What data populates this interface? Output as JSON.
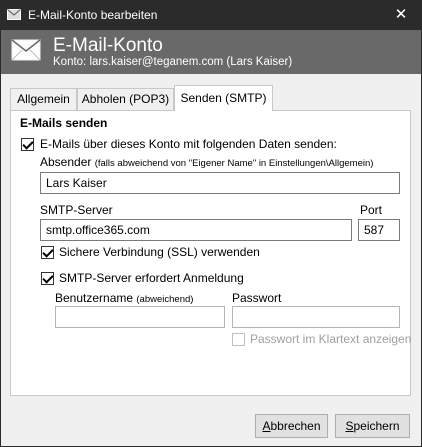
{
  "window": {
    "title": "E-Mail-Konto bearbeiten",
    "close_glyph": "✕",
    "title_icon": "mail-icon"
  },
  "header": {
    "title": "E-Mail-Konto",
    "subtitle": "Konto: lars.kaiser@teganem.com (Lars Kaiser)",
    "icon": "mail-icon"
  },
  "tabs": [
    {
      "label": "Allgemein",
      "active": false
    },
    {
      "label": "Abholen (POP3)",
      "active": false
    },
    {
      "label": "Senden (SMTP)",
      "active": true
    }
  ],
  "send": {
    "section_title": "E-Mails senden",
    "send_via_account": {
      "label": "E-Mails über dieses Konto mit folgenden Daten senden:",
      "checked": true
    },
    "sender_label": "Absender",
    "sender_hint": "(falls abweichend von \"Eigener Name\" in Einstellungen\\Allgemein)",
    "sender_value": "Lars Kaiser",
    "smtp_label": "SMTP-Server",
    "smtp_value": "smtp.office365.com",
    "port_label": "Port",
    "port_value": "587",
    "ssl": {
      "label": "Sichere Verbindung (SSL) verwenden",
      "checked": true
    },
    "auth": {
      "label": "SMTP-Server erfordert Anmeldung",
      "checked": true
    },
    "username_label": "Benutzername",
    "username_hint": "(abweichend)",
    "username_value": "",
    "password_label": "Passwort",
    "password_value": "",
    "show_password": {
      "label": "Passwort im Klartext anzeigen",
      "checked": false,
      "disabled": true
    }
  },
  "buttons": {
    "cancel_prefix": "",
    "cancel_accel": "A",
    "cancel_rest": "bbrechen",
    "save_prefix": "",
    "save_accel": "S",
    "save_rest": "peichern"
  }
}
